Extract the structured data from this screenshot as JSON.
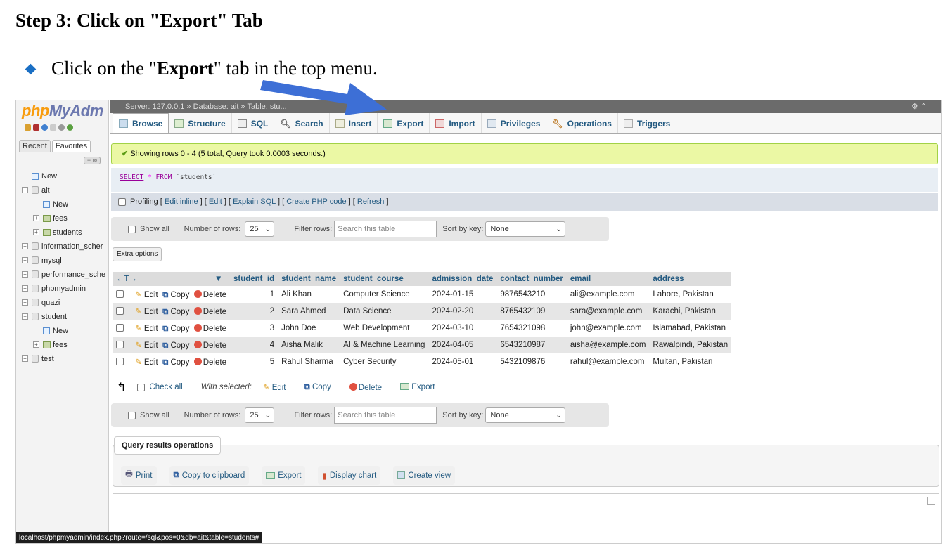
{
  "doc": {
    "title": "Step 3: Click on \"Export\" Tab",
    "bullet_pre": "Click on the \"",
    "bullet_bold": "Export",
    "bullet_post": "\" tab in the top menu."
  },
  "nav": {
    "logo_a": "php",
    "logo_b": "MyAdm",
    "tabs": [
      "Recent",
      "Favorites"
    ],
    "tree": [
      {
        "label": "New",
        "indent": 0,
        "type": "new"
      },
      {
        "label": "ait",
        "indent": 0,
        "type": "db",
        "expanded": true
      },
      {
        "label": "New",
        "indent": 1,
        "type": "new"
      },
      {
        "label": "fees",
        "indent": 1,
        "type": "table"
      },
      {
        "label": "students",
        "indent": 1,
        "type": "table"
      },
      {
        "label": "information_scher",
        "indent": 0,
        "type": "db"
      },
      {
        "label": "mysql",
        "indent": 0,
        "type": "db"
      },
      {
        "label": "performance_sche",
        "indent": 0,
        "type": "db"
      },
      {
        "label": "phpmyadmin",
        "indent": 0,
        "type": "db"
      },
      {
        "label": "quazi",
        "indent": 0,
        "type": "db"
      },
      {
        "label": "student",
        "indent": 0,
        "type": "db",
        "expanded": true
      },
      {
        "label": "New",
        "indent": 1,
        "type": "new"
      },
      {
        "label": "fees",
        "indent": 1,
        "type": "table"
      },
      {
        "label": "test",
        "indent": 0,
        "type": "db"
      }
    ]
  },
  "status_url": "localhost/phpmyadmin/index.php?route=/sql&pos=0&db=ait&table=students#",
  "breadcrumb": "Server: 127.0.0.1 » Database: ait » Table: stu...",
  "tabs": [
    "Browse",
    "Structure",
    "SQL",
    "Search",
    "Insert",
    "Export",
    "Import",
    "Privileges",
    "Operations",
    "Triggers"
  ],
  "success_msg": "Showing rows 0 - 4 (5 total, Query took 0.0003 seconds.)",
  "sql": {
    "select": "SELECT",
    "star": "*",
    "from": "FROM",
    "table": "`students`"
  },
  "profiling": {
    "label": "Profiling",
    "links": [
      "Edit inline",
      "Edit",
      "Explain SQL",
      "Create PHP code",
      "Refresh"
    ]
  },
  "navbar": {
    "show_all": "Show all",
    "rows_label": "Number of rows:",
    "rows_value": "25",
    "filter_label": "Filter rows:",
    "filter_placeholder": "Search this table",
    "sort_label": "Sort by key:",
    "sort_value": "None"
  },
  "extra_options": "Extra options",
  "table": {
    "columns": [
      "student_id",
      "student_name",
      "student_course",
      "admission_date",
      "contact_number",
      "email",
      "address"
    ],
    "actions": [
      "Edit",
      "Copy",
      "Delete"
    ],
    "rows": [
      [
        "1",
        "Ali Khan",
        "Computer Science",
        "2024-01-15",
        "9876543210",
        "ali@example.com",
        "Lahore, Pakistan"
      ],
      [
        "2",
        "Sara Ahmed",
        "Data Science",
        "2024-02-20",
        "8765432109",
        "sara@example.com",
        "Karachi, Pakistan"
      ],
      [
        "3",
        "John Doe",
        "Web Development",
        "2024-03-10",
        "7654321098",
        "john@example.com",
        "Islamabad, Pakistan"
      ],
      [
        "4",
        "Aisha Malik",
        "AI & Machine Learning",
        "2024-04-05",
        "6543210987",
        "aisha@example.com",
        "Rawalpindi, Pakistan"
      ],
      [
        "5",
        "Rahul Sharma",
        "Cyber Security",
        "2024-05-01",
        "5432109876",
        "rahul@example.com",
        "Multan, Pakistan"
      ]
    ]
  },
  "with_selected": {
    "check_all": "Check all",
    "label": "With selected:",
    "edit": "Edit",
    "copy": "Copy",
    "delete": "Delete",
    "export": "Export"
  },
  "qro": {
    "title": "Query results operations",
    "ops": [
      "Print",
      "Copy to clipboard",
      "Export",
      "Display chart",
      "Create view"
    ]
  },
  "colors": {
    "arrow": "#3d6fd6",
    "link": "#235a81",
    "success_bg": "#ebf8a4"
  }
}
